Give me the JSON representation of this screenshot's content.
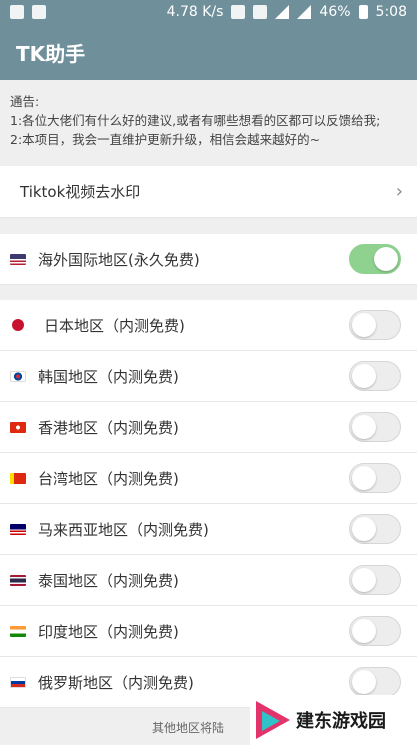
{
  "statusbar": {
    "speed": "4.78 K/s",
    "battery": "46%",
    "time": "5:08"
  },
  "app": {
    "title": "TK助手"
  },
  "notice": {
    "heading": "通告:",
    "line1": "1:各位大佬们有什么好的建议,或者有哪些想看的区都可以反馈给我;",
    "line2": "2:本项目，我会一直维护更新升级，相信会越来越好的~"
  },
  "menu": {
    "watermark_label": "Tiktok视频去水印"
  },
  "global_region": {
    "label": "海外国际地区(永久免费)",
    "enabled": true
  },
  "regions": [
    {
      "label": "日本地区（内测免费)",
      "flag": "jp",
      "enabled": false
    },
    {
      "label": "韩国地区（内测免费)",
      "flag": "kr",
      "enabled": false
    },
    {
      "label": "香港地区（内测免费)",
      "flag": "hk",
      "enabled": false
    },
    {
      "label": "台湾地区（内测免费)",
      "flag": "tw",
      "enabled": false
    },
    {
      "label": "马来西亚地区（内测免费)",
      "flag": "my",
      "enabled": false
    },
    {
      "label": "泰国地区（内测免费)",
      "flag": "th",
      "enabled": false
    },
    {
      "label": "印度地区（内测免费)",
      "flag": "in",
      "enabled": false
    },
    {
      "label": "俄罗斯地区（内测免费)",
      "flag": "ru",
      "enabled": false
    }
  ],
  "footer": {
    "note": "其他地区将陆"
  },
  "watermark_overlay": {
    "text": "建东游戏园"
  },
  "colors": {
    "appbar": "#6f8f9a",
    "toggle_on": "#8fd18f"
  }
}
